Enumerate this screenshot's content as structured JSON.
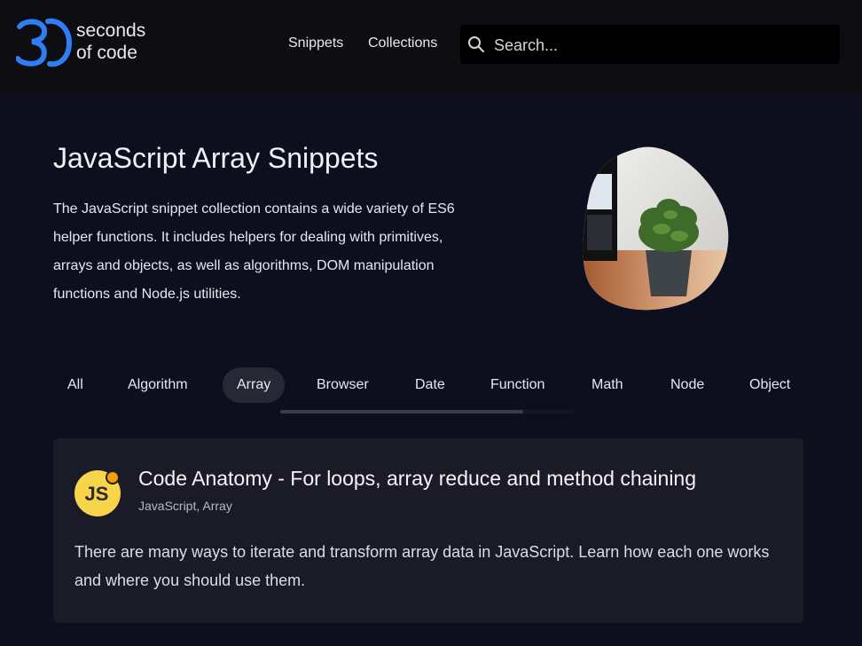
{
  "header": {
    "logo": {
      "number": "30",
      "line1": "seconds",
      "line2": "of code"
    },
    "nav": [
      {
        "label": "Snippets"
      },
      {
        "label": "Collections"
      }
    ],
    "search": {
      "placeholder": "Search..."
    }
  },
  "hero": {
    "title": "JavaScript Array Snippets",
    "description": "The JavaScript snippet collection contains a wide variety of ES6 helper functions. It includes helpers for dealing with primitives, arrays and objects, as well as algorithms, DOM manipulation functions and Node.js utilities."
  },
  "tabs": {
    "items": [
      {
        "label": "All"
      },
      {
        "label": "Algorithm"
      },
      {
        "label": "Array"
      },
      {
        "label": "Browser"
      },
      {
        "label": "Date"
      },
      {
        "label": "Function"
      },
      {
        "label": "Math"
      },
      {
        "label": "Node"
      },
      {
        "label": "Object"
      }
    ],
    "active": "Array"
  },
  "card": {
    "badge": "JS",
    "title": "Code Anatomy - For loops, array reduce and method chaining",
    "tags": "JavaScript, Array",
    "description": "There are many ways to iterate and transform array data in JavaScript. Learn how each one works and where you should use them."
  },
  "colors": {
    "background": "#0d0f1f",
    "header": "#0d0d12",
    "logo_blue": "#2f7ef5",
    "card": "#1a1b26",
    "js_badge": "#f7d54a",
    "badge_dot": "#f59e0b"
  },
  "icons": [
    "search-icon",
    "js-badge-icon"
  ]
}
